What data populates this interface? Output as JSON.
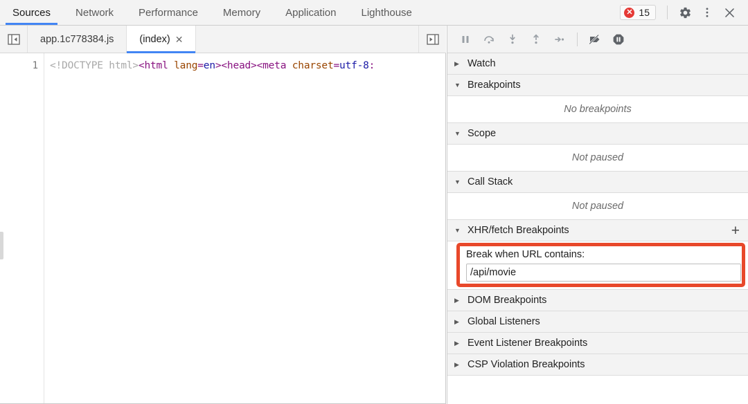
{
  "panel_tabs": [
    {
      "label": "Sources",
      "active": true
    },
    {
      "label": "Network",
      "active": false
    },
    {
      "label": "Performance",
      "active": false
    },
    {
      "label": "Memory",
      "active": false
    },
    {
      "label": "Application",
      "active": false
    },
    {
      "label": "Lighthouse",
      "active": false
    }
  ],
  "toolbar_right": {
    "error_count": "15",
    "error_glyph": "✕",
    "settings_icon": "gear-icon",
    "more_icon": "more-vertical-icon",
    "close_icon": "close-icon"
  },
  "file_tabs": {
    "show_navigator_icon": "show-navigator-panel-icon",
    "show_debugger_icon": "show-debugger-panel-icon",
    "tabs": [
      {
        "label": "app.1c778384.js",
        "active": false,
        "closable": false
      },
      {
        "label": "(index)",
        "active": true,
        "closable": true,
        "close_glyph": "✕"
      }
    ]
  },
  "editor": {
    "line_number": "1",
    "code_tokens": [
      {
        "text": "<!DOCTYPE html>",
        "type": "doctype"
      },
      {
        "text": "<html",
        "type": "tag"
      },
      {
        "text": " ",
        "type": "plain"
      },
      {
        "text": "lang",
        "type": "attr"
      },
      {
        "text": "=",
        "type": "punct"
      },
      {
        "text": "en",
        "type": "val"
      },
      {
        "text": ">",
        "type": "tag"
      },
      {
        "text": "<head>",
        "type": "tag"
      },
      {
        "text": "<meta",
        "type": "tag"
      },
      {
        "text": " ",
        "type": "plain"
      },
      {
        "text": "charset",
        "type": "attr"
      },
      {
        "text": "=",
        "type": "punct"
      },
      {
        "text": "utf-8",
        "type": "val"
      },
      {
        "text": ":",
        "type": "punct"
      }
    ]
  },
  "debugger_toolbar": {
    "buttons": [
      {
        "name": "pause-script-execution-button",
        "glyph": "pause"
      },
      {
        "name": "step-over-next-function-call-button",
        "glyph": "step-over"
      },
      {
        "name": "step-into-next-function-call-button",
        "glyph": "step-into"
      },
      {
        "name": "step-out-of-current-function-button",
        "glyph": "step-out"
      },
      {
        "name": "step-button",
        "glyph": "step"
      },
      {
        "name": "deactivate-breakpoints-button",
        "glyph": "deactivate"
      },
      {
        "name": "pause-on-exceptions-button",
        "glyph": "pause-on-exceptions"
      }
    ]
  },
  "sidebar_sections": [
    {
      "title": "Watch",
      "expanded": false,
      "triangle": "▶",
      "body": null,
      "add_button": null
    },
    {
      "title": "Breakpoints",
      "expanded": true,
      "triangle": "▼",
      "body": "No breakpoints",
      "add_button": null
    },
    {
      "title": "Scope",
      "expanded": true,
      "triangle": "▼",
      "body": "Not paused",
      "add_button": null
    },
    {
      "title": "Call Stack",
      "expanded": true,
      "triangle": "▼",
      "body": "Not paused",
      "add_button": null
    },
    {
      "title": "XHR/fetch Breakpoints",
      "expanded": true,
      "triangle": "▼",
      "body": null,
      "add_button": "+"
    },
    {
      "title": "DOM Breakpoints",
      "expanded": false,
      "triangle": "▶",
      "body": null,
      "add_button": null
    },
    {
      "title": "Global Listeners",
      "expanded": false,
      "triangle": "▶",
      "body": null,
      "add_button": null
    },
    {
      "title": "Event Listener Breakpoints",
      "expanded": false,
      "triangle": "▶",
      "body": null,
      "add_button": null
    },
    {
      "title": "CSP Violation Breakpoints",
      "expanded": false,
      "triangle": "▶",
      "body": null,
      "add_button": null
    }
  ],
  "xhr_breakpoint_editor": {
    "label": "Break when URL contains:",
    "value": "/api/movie",
    "placeholder": "Break when URL contains:",
    "highlight_color": "#e8482a"
  },
  "colors": {
    "accent_blue": "#4285f4",
    "error_red": "#e53935",
    "highlight_red": "#e8482a",
    "header_bg": "#f3f3f3",
    "body_bg": "#ffffff"
  }
}
